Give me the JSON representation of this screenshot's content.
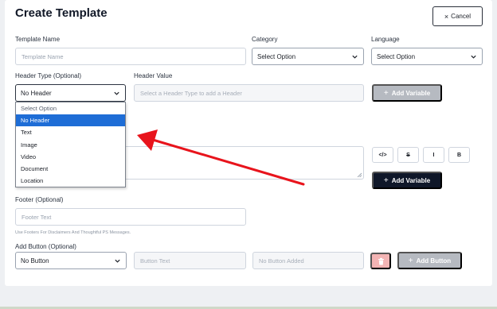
{
  "page": {
    "title": "Create Template",
    "cancel_label": "Cancel"
  },
  "fields": {
    "template_name": {
      "label": "Template Name",
      "placeholder": "Template Name"
    },
    "category": {
      "label": "Category",
      "value": "Select Option"
    },
    "language": {
      "label": "Language",
      "value": "Select Option"
    },
    "header_type": {
      "label": "Header Type (Optional)",
      "value": "No Header"
    },
    "header_value": {
      "label": "Header Value",
      "placeholder": "Select a Header Type to add a Header"
    },
    "footer": {
      "label": "Footer (Optional)",
      "placeholder": "Footer Text",
      "hint": "Use Footers For Disclaimers And Thoughtful PS Messages."
    },
    "add_button": {
      "label": "Add Button (Optional)",
      "value": "No Button",
      "text_placeholder": "Button Text",
      "added_placeholder": "No Button Added"
    }
  },
  "buttons": {
    "add_variable_header": "Add Variable",
    "add_variable_body": "Add Variable",
    "add_button": "Add Button"
  },
  "formatting": {
    "code": "</>",
    "strike": "S",
    "italic": "I",
    "bold": "B"
  },
  "dropdown": {
    "options": [
      "Select Option",
      "No Header",
      "Text",
      "Image",
      "Video",
      "Document",
      "Location"
    ],
    "selected": "No Header"
  },
  "colors": {
    "accent_blue": "#1e6dd6",
    "arrow_red": "#e8141c",
    "dark_button": "#0f1729",
    "disabled_button": "#b6bac1"
  }
}
